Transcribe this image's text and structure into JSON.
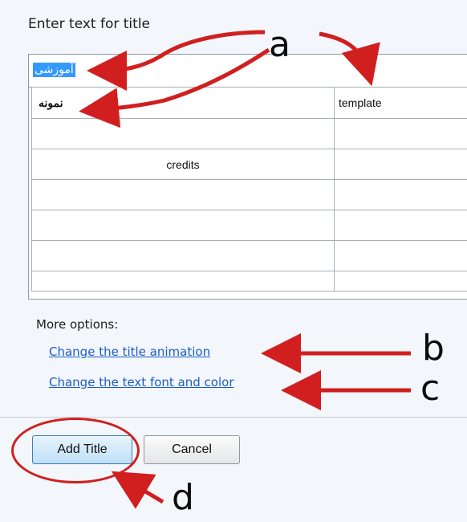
{
  "dialog": {
    "heading": "Enter text for title",
    "title_text": "آموزشی",
    "table": {
      "rows": [
        [
          "نمونه",
          "template"
        ],
        [
          "",
          ""
        ],
        [
          "credits",
          ""
        ],
        [
          "",
          ""
        ],
        [
          "",
          ""
        ],
        [
          "",
          ""
        ],
        [
          "",
          ""
        ]
      ]
    },
    "more_options_label": "More options:",
    "links": {
      "title_animation": "Change the title animation",
      "text_font_color": "Change the text font and color"
    },
    "buttons": {
      "add_title": "Add Title",
      "cancel": "Cancel"
    }
  },
  "annotations": {
    "a": "a",
    "b": "b",
    "c": "c",
    "d": "d",
    "color": "#d11f1f"
  }
}
